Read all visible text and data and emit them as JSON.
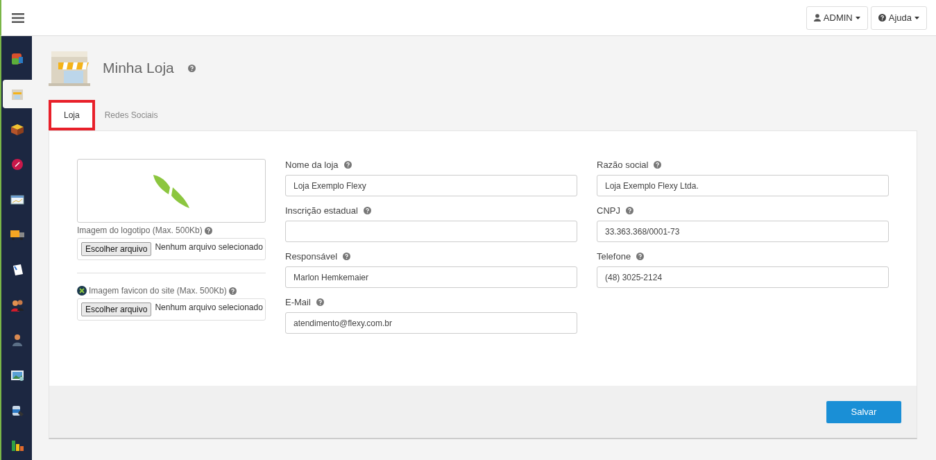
{
  "topbar": {
    "menu": [
      {
        "label": "ADMIN",
        "kind": "user"
      },
      {
        "label": "Ajuda",
        "kind": "help"
      }
    ]
  },
  "sidebar": {
    "items": [
      {
        "selected": false
      },
      {
        "selected": true
      },
      {
        "selected": false
      },
      {
        "selected": false
      },
      {
        "selected": false
      },
      {
        "selected": false
      },
      {
        "selected": false
      },
      {
        "selected": false
      },
      {
        "selected": false
      },
      {
        "selected": false
      },
      {
        "selected": false
      },
      {
        "selected": false
      }
    ]
  },
  "page": {
    "title": "Minha Loja"
  },
  "tabs": [
    {
      "label": "Loja",
      "selected": true,
      "highlighted": true
    },
    {
      "label": "Redes Sociais",
      "selected": false,
      "highlighted": false
    }
  ],
  "uploads": [
    {
      "label": "Imagem do logotipo (Max. 500Kb)",
      "kind": "logo",
      "button": "Escolher arquivo",
      "status": "Nenhum arquivo selecionado"
    },
    {
      "label": "Imagem favicon do site (Max. 500Kb)",
      "kind": "favicon",
      "button": "Escolher arquivo",
      "status": "Nenhum arquivo selecionado"
    }
  ],
  "columns": [
    [
      {
        "label": "Nome da loja",
        "value": "Loja Exemplo Flexy"
      },
      {
        "label": "Inscrição estadual"
      },
      {
        "label": "Responsável",
        "value": "Marlon Hemkemaier"
      },
      {
        "label": "E-Mail",
        "value": "atendimento@flexy.com.br"
      }
    ],
    [
      {
        "label": "Razão social",
        "value": "Loja Exemplo Flexy Ltda."
      },
      {
        "label": "CNPJ",
        "value": "33.363.368/0001-73"
      },
      {
        "label": "Telefone",
        "value": "(48) 3025-2124"
      }
    ]
  ],
  "save_button": "Salvar"
}
